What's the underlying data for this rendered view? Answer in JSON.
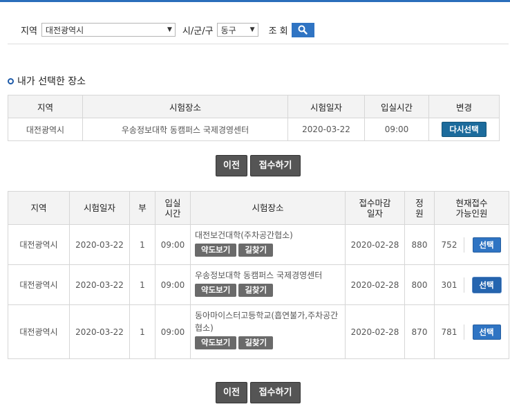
{
  "search": {
    "region_label": "지역",
    "region_value": "대전광역시",
    "district_label": "시/군/구",
    "district_value": "동구",
    "query_label": "조 회"
  },
  "selected": {
    "title": "내가 선택한 장소",
    "headers": [
      "지역",
      "시험장소",
      "시험일자",
      "입실시간",
      "변경"
    ],
    "row": {
      "region": "대전광역시",
      "place": "우송정보대학 동캠퍼스 국제경영센터",
      "date": "2020-03-22",
      "time": "09:00",
      "change_btn": "다시선택"
    }
  },
  "nav1": {
    "prev": "이전",
    "submit": "접수하기"
  },
  "list": {
    "headers": {
      "region": "지역",
      "date": "시험일자",
      "part": "부",
      "entry_time": "입실\n시간",
      "place": "시험장소",
      "deadline": "접수마감\n일자",
      "capacity": "정\n원",
      "available": "현재접수\n가능인원"
    },
    "rows": [
      {
        "region": "대전광역시",
        "date": "2020-03-22",
        "part": "1",
        "time": "09:00",
        "place": "대전보건대학(주차공간협소)",
        "map_btn": "약도보기",
        "route_btn": "길찾기",
        "deadline": "2020-02-28",
        "capacity": "880",
        "available": "752",
        "select_btn": "선택"
      },
      {
        "region": "대전광역시",
        "date": "2020-03-22",
        "part": "1",
        "time": "09:00",
        "place": "우송정보대학 동캠퍼스 국제경영센터",
        "map_btn": "약도보기",
        "route_btn": "길찾기",
        "deadline": "2020-02-28",
        "capacity": "800",
        "available": "301",
        "select_btn": "선택"
      },
      {
        "region": "대전광역시",
        "date": "2020-03-22",
        "part": "1",
        "time": "09:00",
        "place": "동아마이스터고등학교(흡연불가,주차공간협소)",
        "map_btn": "약도보기",
        "route_btn": "길찾기",
        "deadline": "2020-02-28",
        "capacity": "870",
        "available": "781",
        "select_btn": "선택"
      }
    ]
  },
  "nav2": {
    "prev": "이전",
    "submit": "접수하기"
  }
}
